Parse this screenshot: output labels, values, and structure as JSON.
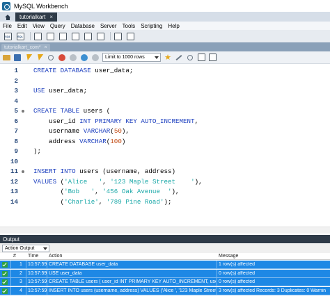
{
  "window": {
    "title": "MySQL Workbench"
  },
  "tabs": {
    "connection_label": "tutorialkart"
  },
  "menu": [
    "File",
    "Edit",
    "View",
    "Query",
    "Database",
    "Server",
    "Tools",
    "Scripting",
    "Help"
  ],
  "query_tab": {
    "label": "tutorialkart_com*"
  },
  "editor_toolbar": {
    "limit_label": "Limit to 1000 rows"
  },
  "editor": {
    "lines": [
      {
        "n": "1",
        "fold": false,
        "html": "<span class='kw'>CREATE DATABASE</span> user_data;"
      },
      {
        "n": "2",
        "fold": false,
        "html": ""
      },
      {
        "n": "3",
        "fold": false,
        "html": "<span class='kw'>USE</span> user_data;"
      },
      {
        "n": "4",
        "fold": false,
        "html": ""
      },
      {
        "n": "5",
        "fold": true,
        "html": "<span class='kw'>CREATE TABLE</span> users ("
      },
      {
        "n": "6",
        "fold": false,
        "html": "    user_id <span class='kw'>INT PRIMARY KEY AUTO_INCREMENT</span>,"
      },
      {
        "n": "7",
        "fold": false,
        "html": "    username <span class='kw'>VARCHAR</span>(<span class='num'>50</span>),"
      },
      {
        "n": "8",
        "fold": false,
        "html": "    address <span class='kw'>VARCHAR</span>(<span class='num'>100</span>)"
      },
      {
        "n": "9",
        "fold": false,
        "html": ");"
      },
      {
        "n": "10",
        "fold": false,
        "html": ""
      },
      {
        "n": "11",
        "fold": true,
        "html": "<span class='kw'>INSERT INTO</span> users (username, address)"
      },
      {
        "n": "12",
        "fold": false,
        "html": "<span class='kw'>VALUES</span> (<span class='str'>'Alice   '</span>, <span class='str'>'123 Maple Street    '</span>),"
      },
      {
        "n": "13",
        "fold": false,
        "html": "       (<span class='str'>'Bob   '</span>, <span class='str'>'456 Oak Avenue  '</span>),"
      },
      {
        "n": "14",
        "fold": false,
        "html": "       (<span class='str'>'Charlie'</span>, <span class='str'>'789 Pine Road'</span>);"
      }
    ]
  },
  "output": {
    "header": "Output",
    "select_label": "Action Output",
    "columns": {
      "num": "#",
      "time": "Time",
      "action": "Action",
      "message": "Message"
    },
    "rows": [
      {
        "num": "1",
        "time": "10:57:59",
        "action": "CREATE DATABASE user_data",
        "message": "1 row(s) affected"
      },
      {
        "num": "2",
        "time": "10:57:59",
        "action": "USE user_data",
        "message": "0 row(s) affected"
      },
      {
        "num": "3",
        "time": "10:57:59",
        "action": "CREATE TABLE users (     user_id INT PRIMARY KEY AUTO_INCREMENT,     userna...",
        "message": "0 row(s) affected"
      },
      {
        "num": "4",
        "time": "10:57:59",
        "action": "INSERT INTO users (username, address) VALUES ('Alice   ', '123 Maple Street   '),...",
        "message": "3 row(s) affected Records: 3  Duplicates: 0  Warnin"
      }
    ]
  },
  "colors": {
    "accent": "#1e88e5",
    "dark_header": "#2f3b48",
    "keyword": "#1c3fbf",
    "string": "#1aa8a8",
    "number": "#c24a12"
  }
}
